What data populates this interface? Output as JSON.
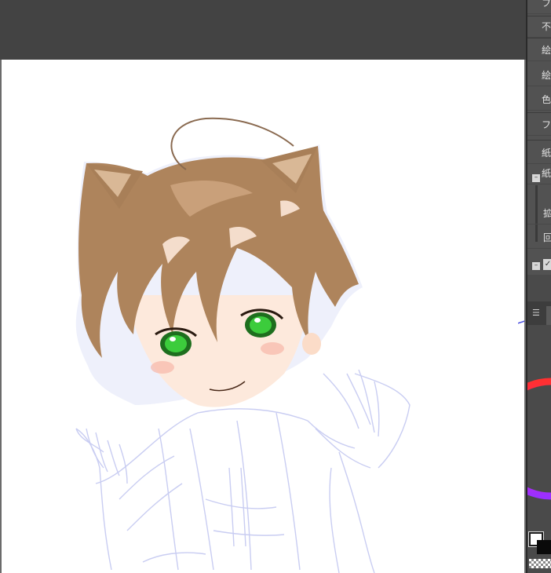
{
  "menu": {
    "items": [
      {
        "label": "フ"
      },
      {
        "label": "不"
      },
      {
        "label": "絵"
      },
      {
        "label": "絵"
      },
      {
        "label": "色"
      },
      {
        "label": "フ"
      },
      {
        "label": "紙"
      },
      {
        "label": "紙"
      },
      {
        "label": "拡"
      },
      {
        "label": "回"
      }
    ]
  },
  "colors": {
    "hair": "#b08660",
    "eyes": "#2fb02f",
    "sketch_line": "#c8ccf0",
    "fg_color": "#ffffff",
    "bg_color": "#0a0a0a"
  },
  "icons": {
    "panel_menu": "panel-menu-icon",
    "collapse": "collapse-icon",
    "check": "check-icon",
    "color_wheel": "color-wheel-icon"
  }
}
